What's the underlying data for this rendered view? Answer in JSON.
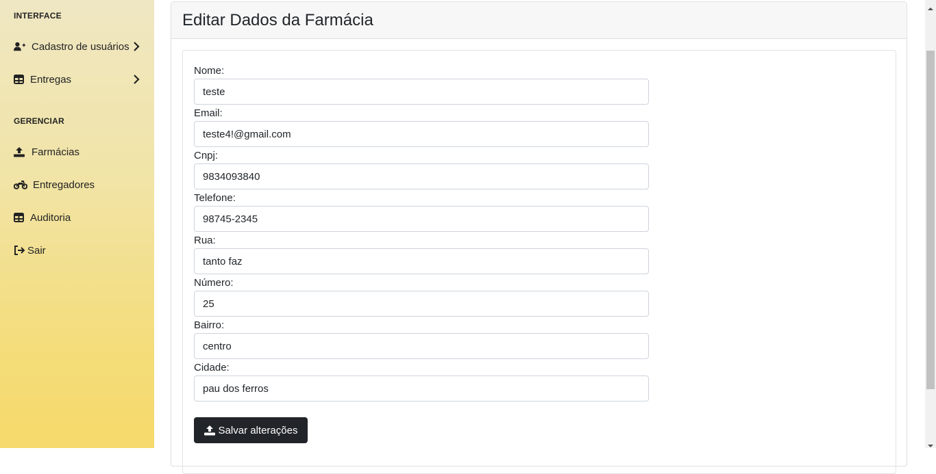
{
  "sidebar": {
    "section_interface": "INTERFACE",
    "cadastro_label": "Cadastro de usuários",
    "entregas_label": "Entregas",
    "section_gerenciar": "GERENCIAR",
    "farmacias_label": "Farmácias",
    "entregadores_label": "Entregadores",
    "auditoria_label": "Auditoria",
    "sair_label": "Sair"
  },
  "page": {
    "title": "Editar Dados da Farmácia"
  },
  "form": {
    "nome_label": "Nome:",
    "nome_value": "teste",
    "email_label": "Email:",
    "email_value": "teste4!@gmail.com",
    "cnpj_label": "Cnpj:",
    "cnpj_value": "9834093840",
    "telefone_label": "Telefone:",
    "telefone_value": "98745-2345",
    "rua_label": "Rua:",
    "rua_value": "tanto faz",
    "numero_label": "Número:",
    "numero_value": "25",
    "bairro_label": "Bairro:",
    "bairro_value": "centro",
    "cidade_label": "Cidade:",
    "cidade_value": "pau dos ferros",
    "save_label": "Salvar alterações"
  },
  "colors": {
    "sidebar_top": "#efe7c3",
    "sidebar_bottom": "#f6d96b",
    "button_bg": "#212529"
  }
}
